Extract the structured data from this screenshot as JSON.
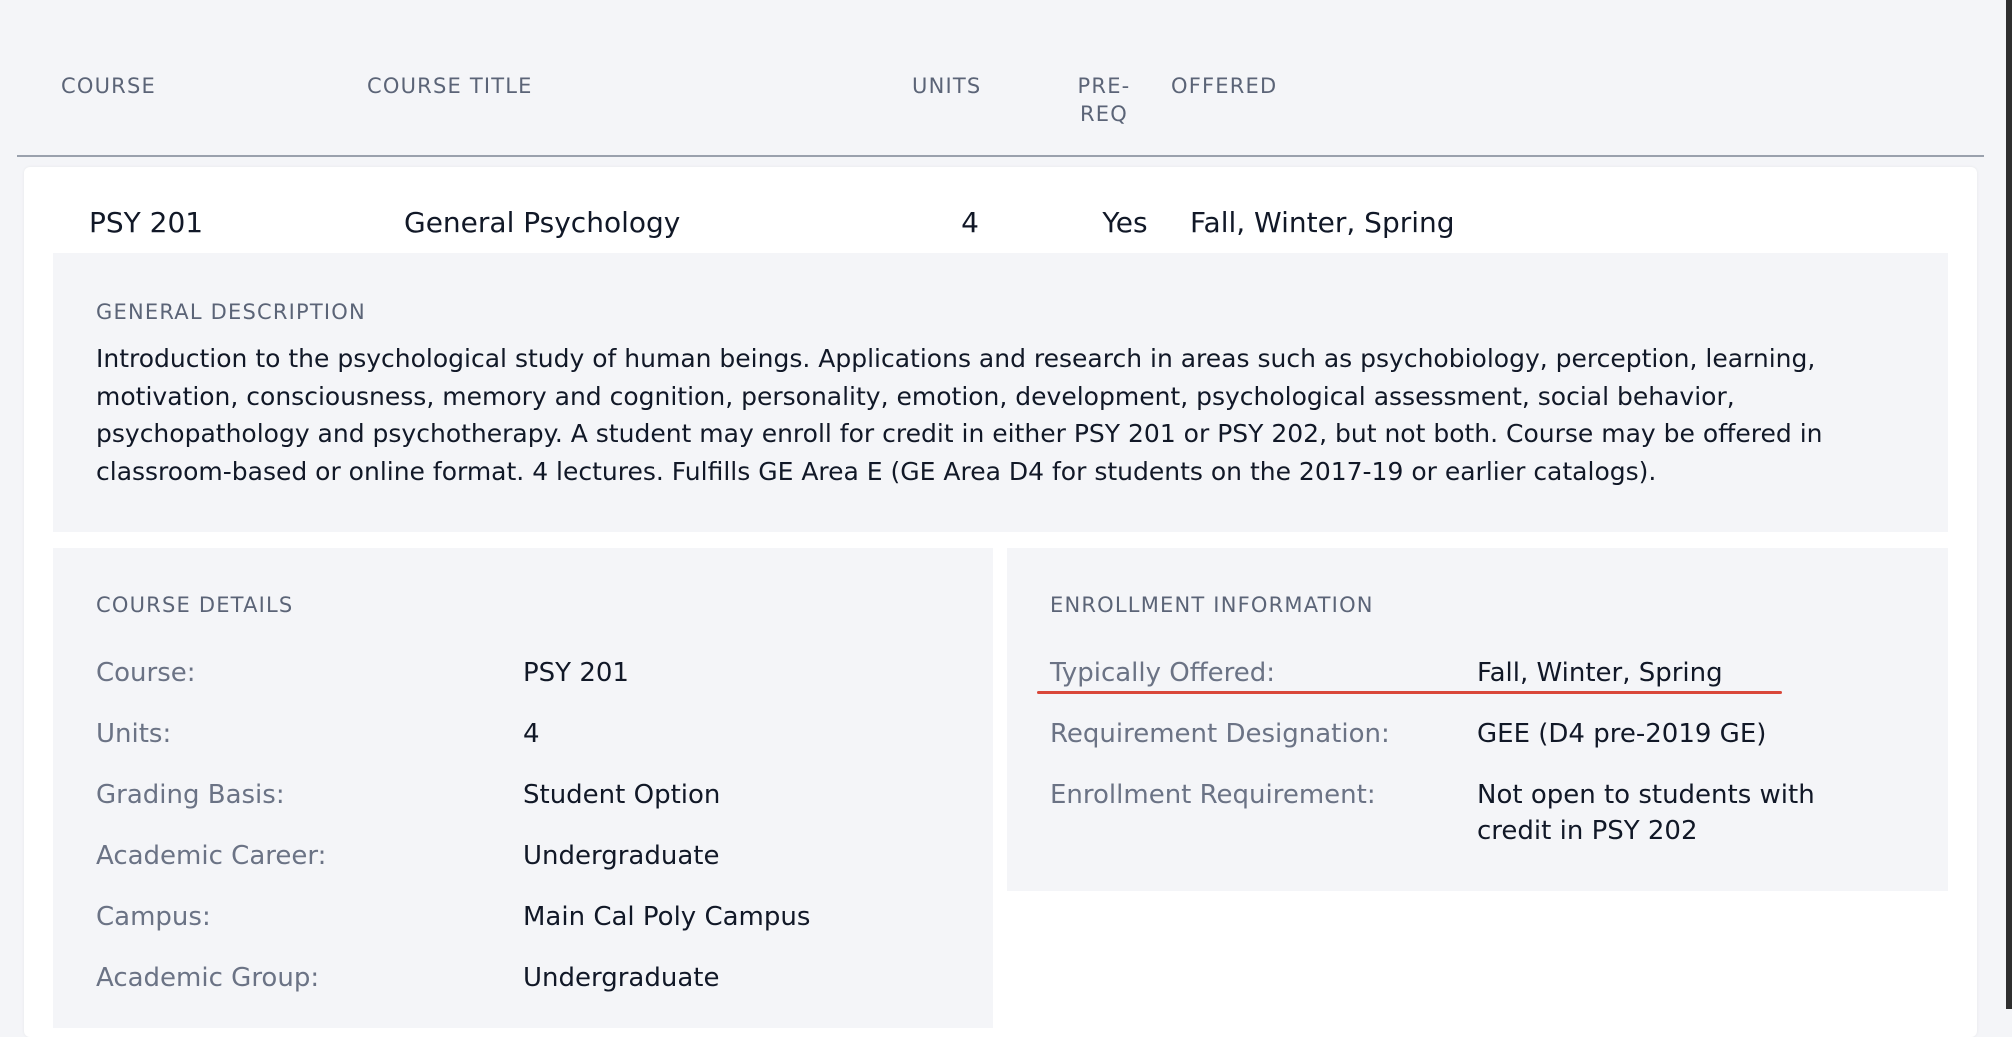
{
  "table_header": {
    "course": "COURSE",
    "course_title": "COURSE TITLE",
    "units": "UNITS",
    "prereq_line1": "PRE-",
    "prereq_line2": "REQ",
    "offered": "OFFERED"
  },
  "course_row": {
    "course": "PSY 201",
    "title": "General Psychology",
    "units": "4",
    "prereq": "Yes",
    "offered": "Fall, Winter, Spring"
  },
  "general_description": {
    "label": "GENERAL DESCRIPTION",
    "text": "Introduction to the psychological study of human beings. Applications and research in areas such as psychobiology, perception, learning, motivation, consciousness, memory and cognition, personality, emotion, development, psychological assessment, social behavior, psychopathology and psychotherapy. A student may enroll for credit in either PSY 201 or PSY 202, but not both. Course may be offered in classroom-based or online format. 4 lectures. Fulfills GE Area E (GE Area D4 for students on the 2017-19 or earlier catalogs)."
  },
  "course_details": {
    "label": "COURSE DETAILS",
    "items": [
      {
        "key": "Course:",
        "value": "PSY 201"
      },
      {
        "key": "Units:",
        "value": "4"
      },
      {
        "key": "Grading Basis:",
        "value": "Student Option"
      },
      {
        "key": "Academic Career:",
        "value": "Undergraduate"
      },
      {
        "key": "Campus:",
        "value": "Main Cal Poly Campus"
      },
      {
        "key": "Academic Group:",
        "value": "Undergraduate"
      }
    ]
  },
  "enrollment_information": {
    "label": "ENROLLMENT INFORMATION",
    "items": [
      {
        "key": "Typically Offered:",
        "value": "Fall, Winter, Spring"
      },
      {
        "key": "Requirement Designation:",
        "value": "GEE (D4 pre-2019 GE)"
      },
      {
        "key": "Enrollment Requirement:",
        "value": "Not open to students with credit in PSY 202"
      }
    ]
  },
  "colors": {
    "background": "#f4f5f8",
    "card": "#ffffff",
    "label_gray": "#6b7385",
    "highlight_red": "#d9473a"
  }
}
